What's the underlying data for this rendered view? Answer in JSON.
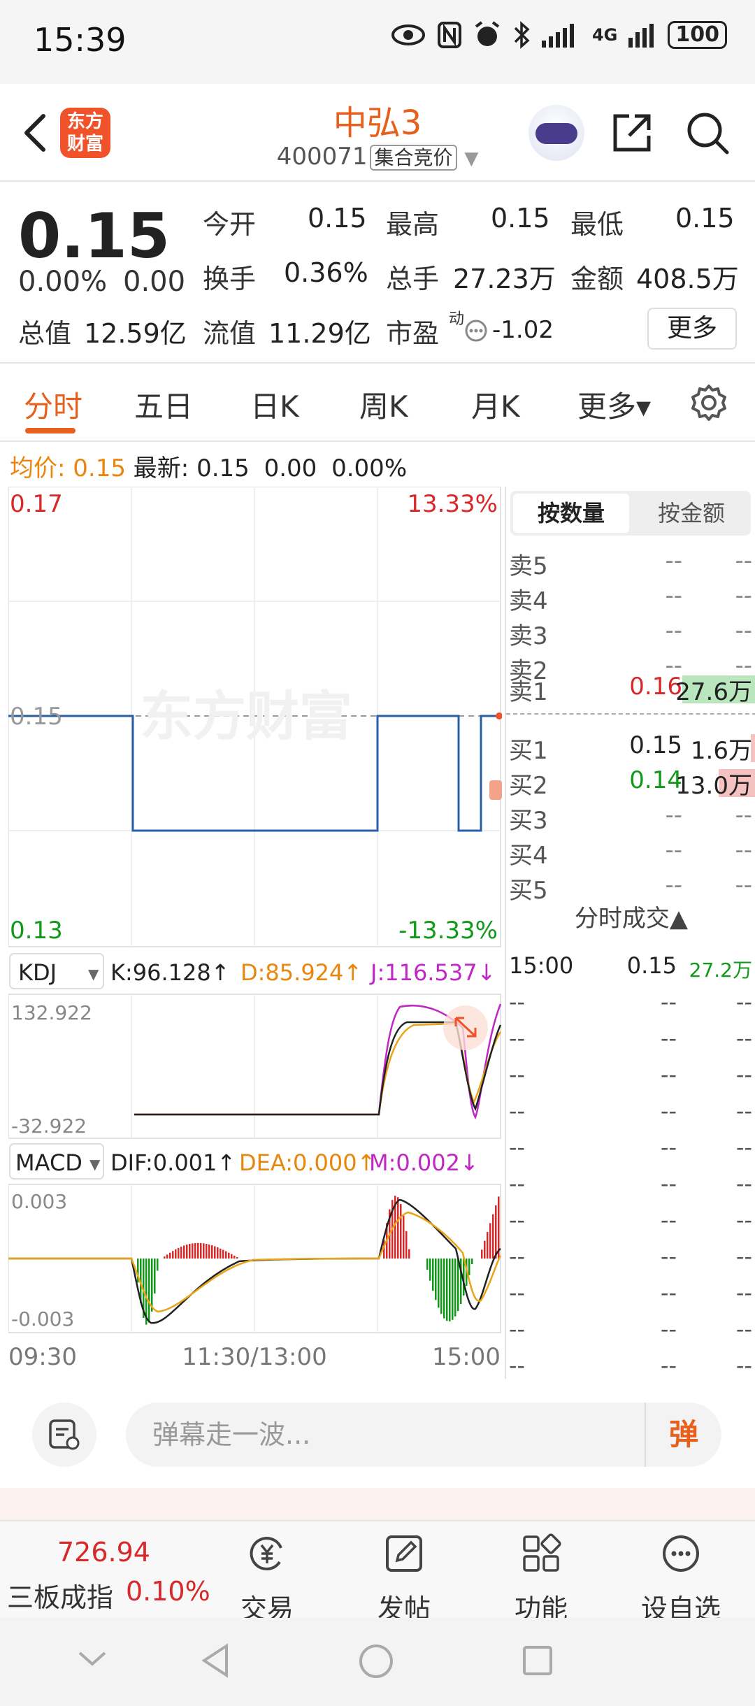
{
  "status_bar": {
    "time": "15:39",
    "network": "4G",
    "battery": "100"
  },
  "header": {
    "logo_line1": "东方",
    "logo_line2": "财富",
    "stock_name": "中弘3",
    "stock_code": "400071",
    "auction_badge": "集合竞价"
  },
  "quote": {
    "price": "0.15",
    "change_pct": "0.00%",
    "change": "0.00",
    "open_label": "今开",
    "open": "0.15",
    "high_label": "最高",
    "high": "0.15",
    "low_label": "最低",
    "low": "0.15",
    "turnover_label": "换手",
    "turnover": "0.36%",
    "volume_label": "总手",
    "volume": "27.23万",
    "amount_label": "金额",
    "amount": "408.5万",
    "mktcap_label": "总值",
    "mktcap": "12.59亿",
    "float_label": "流值",
    "float_cap": "11.29亿",
    "pe_label": "市盈",
    "pe_sup": "动",
    "pe": "-1.02",
    "more_button": "更多"
  },
  "tabs": [
    "分时",
    "五日",
    "日K",
    "周K",
    "月K",
    "更多▾"
  ],
  "info_line": {
    "avg_label": "均价:",
    "avg": "0.15",
    "last_label": "最新:",
    "last": "0.15",
    "chg": "0.00",
    "pct": "0.00%"
  },
  "chart": {
    "watermark": "东方财富",
    "price_top": "0.17",
    "pct_top": "13.33%",
    "price_mid": "0.15",
    "price_bottom": "0.13",
    "pct_bottom": "-13.33%",
    "kdj_label": "KDJ",
    "kdj_k": "K:96.128↑",
    "kdj_d": "D:85.924↑",
    "kdj_j": "J:116.537↓",
    "kdj_max": "132.922",
    "kdj_min": "-32.922",
    "macd_label": "MACD",
    "macd_dif": "DIF:0.001↑",
    "macd_dea": "DEA:0.000↑",
    "macd_m": "M:0.002↓",
    "macd_max": "0.003",
    "macd_min": "-0.003",
    "time_start": "09:30",
    "time_mid": "11:30/13:00",
    "time_end": "15:00",
    "colors": {
      "price": "#2a5ea8",
      "up": "#d7282a",
      "down": "#119a1a",
      "dea": "#e9a418",
      "j": "#c126c6"
    }
  },
  "order_book": {
    "tab_qty": "按数量",
    "tab_amount": "按金额",
    "asks": [
      {
        "label": "卖5",
        "price": "--",
        "vol": "--"
      },
      {
        "label": "卖4",
        "price": "--",
        "vol": "--"
      },
      {
        "label": "卖3",
        "price": "--",
        "vol": "--"
      },
      {
        "label": "卖2",
        "price": "--",
        "vol": "--"
      },
      {
        "label": "卖1",
        "price": "0.16",
        "vol": "27.6万"
      }
    ],
    "bids": [
      {
        "label": "买1",
        "price": "0.15",
        "vol": "1.6万"
      },
      {
        "label": "买2",
        "price": "0.14",
        "vol": "13.0万"
      },
      {
        "label": "买3",
        "price": "--",
        "vol": "--"
      },
      {
        "label": "买4",
        "price": "--",
        "vol": "--"
      },
      {
        "label": "买5",
        "price": "--",
        "vol": "--"
      }
    ],
    "trades_header": "分时成交▲",
    "trades": [
      {
        "time": "15:00",
        "price": "0.15",
        "vol": "27.2万"
      },
      {
        "time": "--",
        "price": "--",
        "vol": "--"
      },
      {
        "time": "--",
        "price": "--",
        "vol": "--"
      },
      {
        "time": "--",
        "price": "--",
        "vol": "--"
      },
      {
        "time": "--",
        "price": "--",
        "vol": "--"
      },
      {
        "time": "--",
        "price": "--",
        "vol": "--"
      },
      {
        "time": "--",
        "price": "--",
        "vol": "--"
      },
      {
        "time": "--",
        "price": "--",
        "vol": "--"
      },
      {
        "time": "--",
        "price": "--",
        "vol": "--"
      },
      {
        "time": "--",
        "price": "--",
        "vol": "--"
      },
      {
        "time": "--",
        "price": "--",
        "vol": "--"
      },
      {
        "time": "--",
        "price": "--",
        "vol": "--"
      }
    ]
  },
  "danmaku": {
    "placeholder": "弹幕走一波...",
    "send": "弹"
  },
  "bottom_nav": {
    "index_value": "726.94",
    "index_name": "三板成指",
    "index_pct": "0.10%",
    "items": [
      "交易",
      "发帖",
      "功能",
      "设自选"
    ]
  }
}
